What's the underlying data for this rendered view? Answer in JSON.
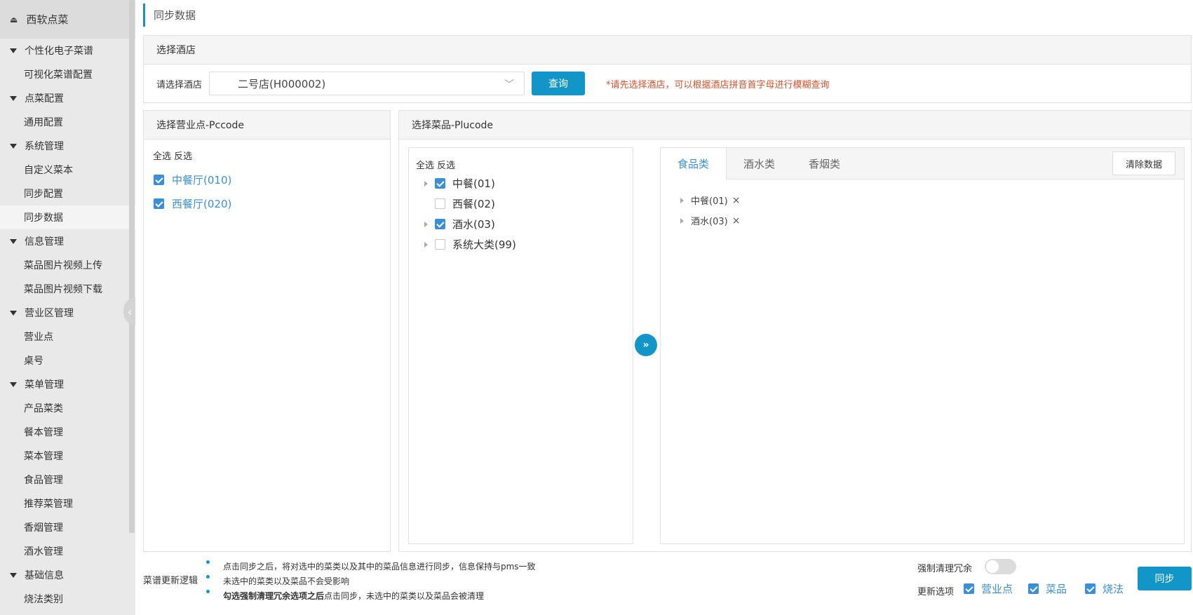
{
  "sidebar": {
    "title": "西软点菜",
    "groups": [
      {
        "label": "个性化电子菜谱",
        "items": [
          "可视化菜谱配置"
        ]
      },
      {
        "label": "点菜配置",
        "items": [
          "通用配置"
        ]
      },
      {
        "label": "系统管理",
        "items": [
          "自定义菜本",
          "同步配置",
          "同步数据"
        ]
      },
      {
        "label": "信息管理",
        "items": [
          "菜品图片视频上传",
          "菜品图片视频下载"
        ]
      },
      {
        "label": "营业区管理",
        "items": [
          "营业点",
          "桌号"
        ]
      },
      {
        "label": "菜单管理",
        "items": [
          "产品菜类",
          "餐本管理",
          "菜本管理",
          "食品管理",
          "推荐菜管理",
          "香烟管理",
          "酒水管理"
        ]
      },
      {
        "label": "基础信息",
        "items": [
          "烧法类别"
        ]
      }
    ],
    "active_item": "同步数据"
  },
  "page": {
    "title": "同步数据"
  },
  "hotel": {
    "panel_title": "选择酒店",
    "select_label": "请选择酒店",
    "selected_hotel": "二号店(H000002)",
    "query_label": "查询",
    "hint": "*请先选择酒店，可以根据酒店拼音首字母进行模糊查询"
  },
  "pccode": {
    "panel_title": "选择营业点-Pccode",
    "select_all": "全选",
    "invert": "反选",
    "items": [
      {
        "label": "中餐厅(010)",
        "checked": true
      },
      {
        "label": "西餐厅(020)",
        "checked": true
      }
    ]
  },
  "plucode": {
    "panel_title": "选择菜品-Plucode",
    "select_all": "全选",
    "invert": "反选",
    "tree": [
      {
        "label": "中餐(01)",
        "checked": true,
        "expandable": true
      },
      {
        "label": "西餐(02)",
        "checked": false,
        "expandable": false
      },
      {
        "label": "酒水(03)",
        "checked": true,
        "expandable": true
      },
      {
        "label": "系统大类(99)",
        "checked": false,
        "expandable": true
      }
    ],
    "transfer_icon": "»",
    "tabs": [
      "食品类",
      "酒水类",
      "香烟类"
    ],
    "active_tab": "食品类",
    "clear_label": "清除数据",
    "selected": [
      "中餐(01)",
      "酒水(03)"
    ],
    "remove_icon": "×"
  },
  "footer": {
    "logic_label": "菜谱更新逻辑",
    "notes": [
      {
        "text": "点击同步之后，将对选中的菜类以及其中的菜品信息进行同步，信息保持与pms一致"
      },
      {
        "text": "未选中的菜类以及菜品不会受影响"
      },
      {
        "bold": "勾选强制清理冗余选项之后",
        "text": "点击同步，未选中的菜类以及菜品会被清理"
      }
    ],
    "force_clean_label": "强制清理冗余",
    "force_clean_on": false,
    "update_options_label": "更新选项",
    "update_options": [
      {
        "label": "营业点",
        "checked": true
      },
      {
        "label": "菜品",
        "checked": true
      },
      {
        "label": "烧法",
        "checked": true
      }
    ],
    "sync_label": "同步"
  }
}
